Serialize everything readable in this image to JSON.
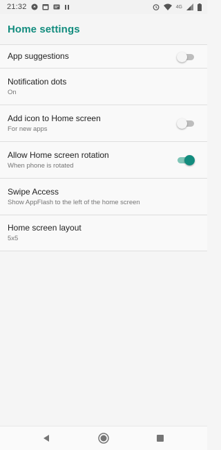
{
  "status_bar": {
    "time": "21:32",
    "network": "4G",
    "icons": [
      "notification-icon",
      "calendar-icon",
      "message-icon",
      "pause-icon",
      "alarm-icon",
      "wifi-icon",
      "signal-icon",
      "battery-icon"
    ]
  },
  "app_bar": {
    "title": "Home settings"
  },
  "settings": [
    {
      "title": "App suggestions",
      "summary": "",
      "toggle": "off"
    },
    {
      "title": "Notification dots",
      "summary": "On"
    },
    {
      "title": "Add icon to Home screen",
      "summary": "For new apps",
      "toggle": "off"
    },
    {
      "title": "Allow Home screen rotation",
      "summary": "When phone is rotated",
      "toggle": "on"
    },
    {
      "title": "Swipe Access",
      "summary": "Show AppFlash to the left of the home screen"
    },
    {
      "title": "Home screen layout",
      "summary": "5x5"
    }
  ],
  "colors": {
    "accent": "#128c7e",
    "toggle_on_track": "#7fc5b7",
    "toggle_off_track": "#bdbdbd",
    "divider": "#dedede"
  },
  "nav_bar": {
    "icons": [
      "back-icon",
      "home-icon",
      "recent-apps-icon"
    ]
  }
}
